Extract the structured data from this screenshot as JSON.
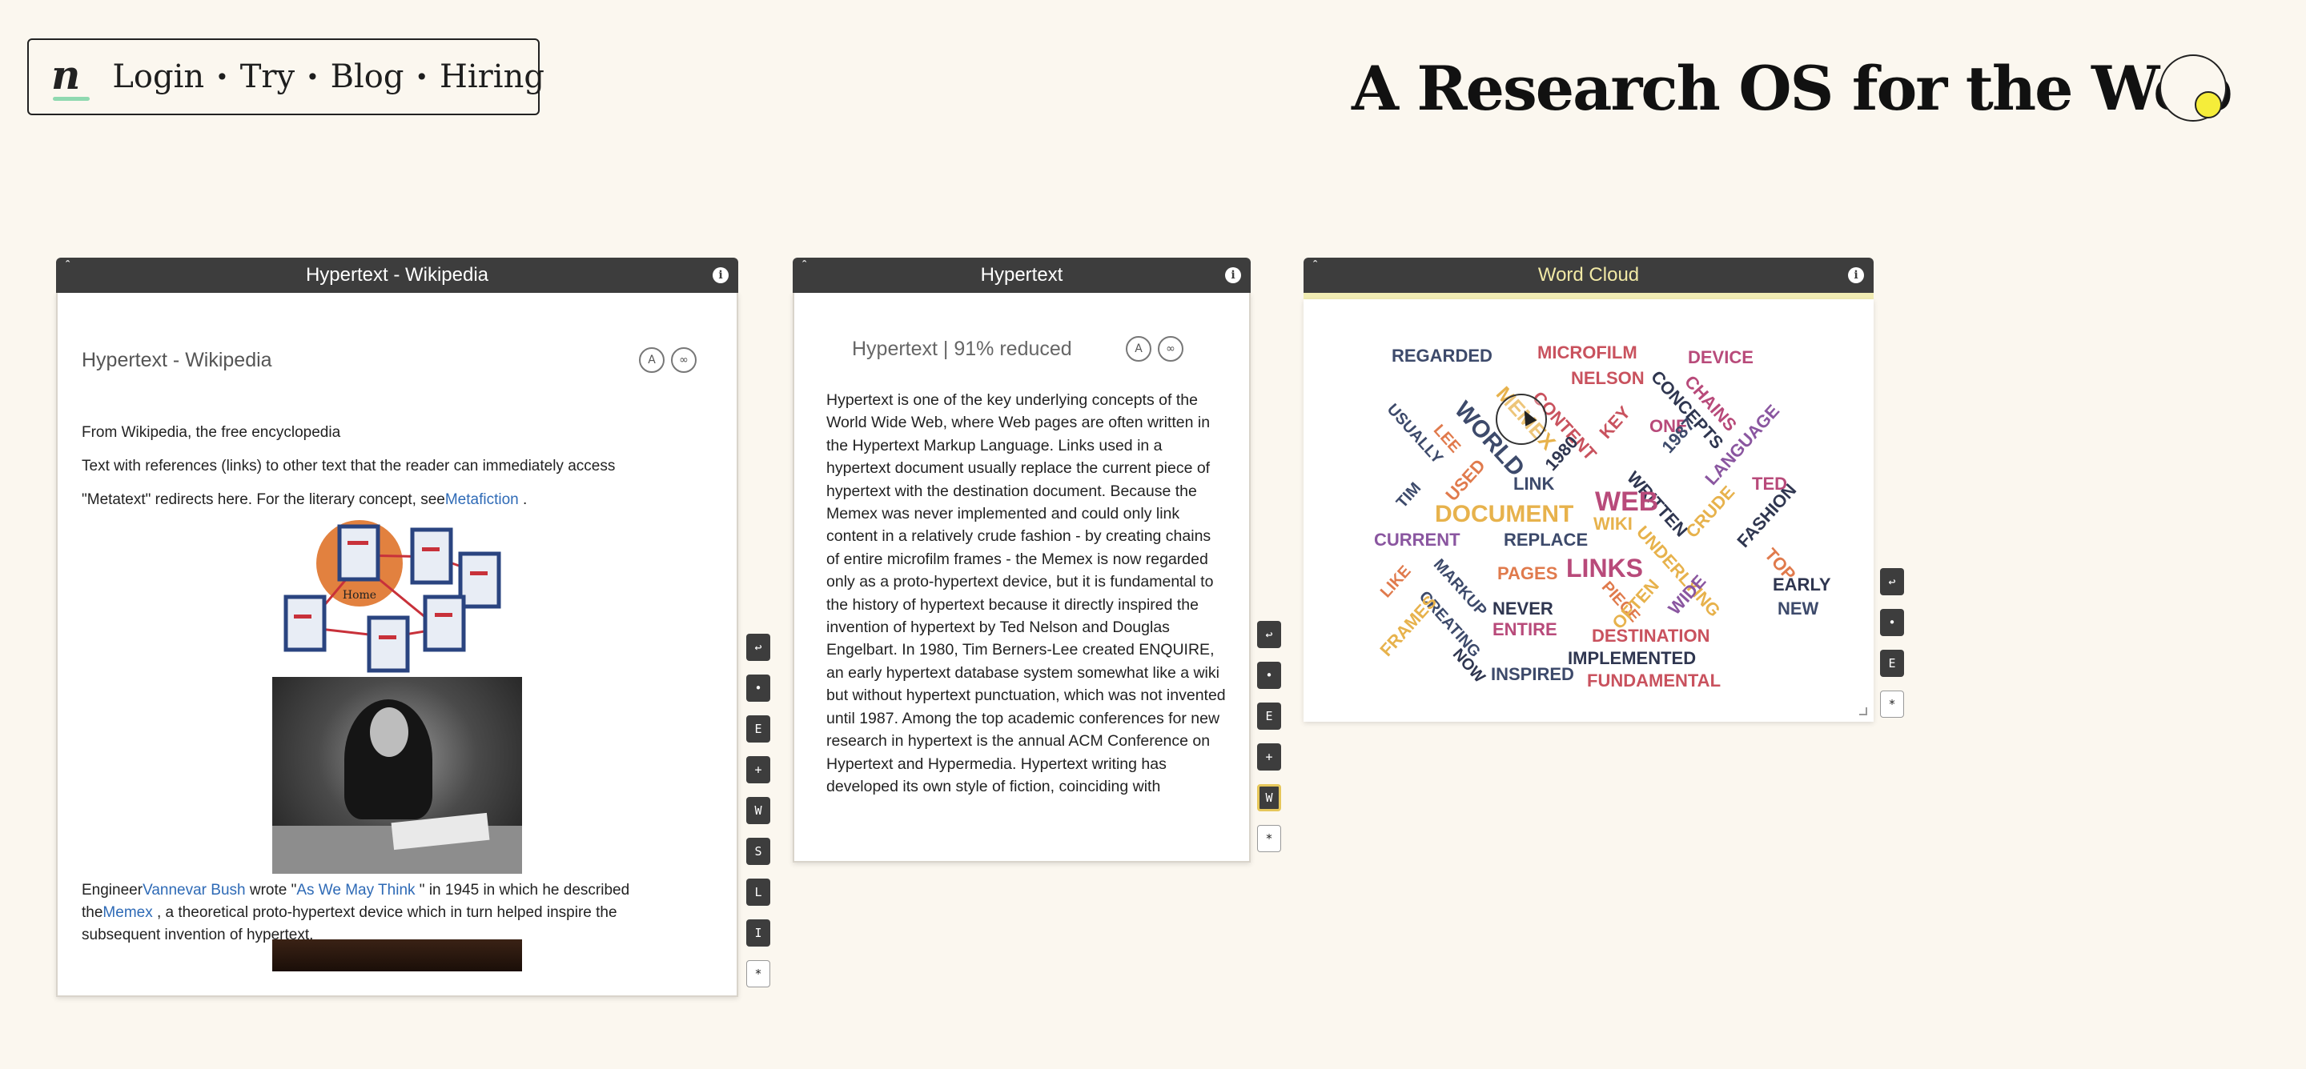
{
  "nav": {
    "items": [
      "Login",
      "Try",
      "Blog",
      "Hiring"
    ],
    "separator": "•",
    "logo_letter": "n"
  },
  "headline": "A Research OS for the Web",
  "panels": {
    "wikipedia": {
      "header": "Hypertext - Wikipedia",
      "title": "Hypertext - Wikipedia",
      "lines": [
        "From Wikipedia, the free encyclopedia",
        "Text with references (links) to other text that the reader can immediately access"
      ],
      "redirect_prefix": "\"Metatext\" redirects here. For the literary concept, see",
      "redirect_link": "Metafiction",
      "redirect_suffix": " .",
      "diagram_label": "Home",
      "caption": {
        "prefix": "Engineer",
        "link1": "Vannevar Bush",
        "mid1": " wrote \"",
        "link2": "As We May Think",
        "mid2": " \" in 1945 in which he described",
        "line2_prefix": "the",
        "link3": "Memex",
        "line2_suffix": " , a theoretical proto-hypertext device which in turn helped inspire the",
        "line3": "subsequent invention of hypertext."
      },
      "tools": [
        "↩",
        "•",
        "E",
        "+",
        "W",
        "S",
        "L",
        "I",
        "*"
      ]
    },
    "summary": {
      "header": "Hypertext",
      "title": "Hypertext | 91% reduced",
      "body": "Hypertext is one of the key underlying concepts of the World Wide Web, where Web pages are often written in the Hypertext Markup Language. Links used in a hypertext document usually replace the current piece of hypertext with the destination document. Because the Memex was never implemented and could only link content in a relatively crude fashion - by creating chains of entire microfilm frames - the Memex is now regarded only as a proto-hypertext device, but it is fundamental to the history of hypertext because it directly inspired the invention of hypertext by Ted Nelson and Douglas Engelbart. In 1980, Tim Berners-Lee created ENQUIRE, an early hypertext database system somewhat like a wiki but without hypertext punctuation, which was not invented until 1987. Among the top academic conferences for new research in hypertext is the annual ACM Conference on Hypertext and Hypermedia. Hypertext writing has developed its own style of fiction, coinciding with",
      "tools": [
        "↩",
        "•",
        "E",
        "+",
        "W",
        "*"
      ],
      "active_tool": "W"
    },
    "wordcloud": {
      "header": "Word Cloud",
      "tools": [
        "↩",
        "•",
        "E",
        "*"
      ],
      "words": [
        {
          "text": "REGARDED",
          "color": "#3d4a6b",
          "size": 22,
          "rot": 0
        },
        {
          "text": "MICROFILM",
          "color": "#c9525e",
          "size": 22,
          "rot": 0
        },
        {
          "text": "DEVICE",
          "color": "#b84a7a",
          "size": 22,
          "rot": 0
        },
        {
          "text": "NELSON",
          "color": "#c9525e",
          "size": 22,
          "rot": 0
        },
        {
          "text": "CONCEPTS",
          "color": "#2f3650",
          "size": 22,
          "rot": 48
        },
        {
          "text": "CHAINS",
          "color": "#b84a7a",
          "size": 22,
          "rot": 48
        },
        {
          "text": "MEMEX",
          "color": "#e7b24c",
          "size": 26,
          "rot": 48
        },
        {
          "text": "CONTENT",
          "color": "#c9525e",
          "size": 22,
          "rot": 48
        },
        {
          "text": "WORLD",
          "color": "#3d4a6b",
          "size": 30,
          "rot": 48
        },
        {
          "text": "USUALLY",
          "color": "#3d4a6b",
          "size": 20,
          "rot": 48
        },
        {
          "text": "LEE",
          "color": "#e07a4c",
          "size": 20,
          "rot": 48
        },
        {
          "text": "KEY",
          "color": "#c9525e",
          "size": 22,
          "rot": -48
        },
        {
          "text": "ONE",
          "color": "#b84a7a",
          "size": 22,
          "rot": 0
        },
        {
          "text": "1987",
          "color": "#3d4a6b",
          "size": 22,
          "rot": -48
        },
        {
          "text": "LANGUAGE",
          "color": "#8a56a0",
          "size": 22,
          "rot": -48
        },
        {
          "text": "1980",
          "color": "#2f3650",
          "size": 22,
          "rot": -48
        },
        {
          "text": "TIM",
          "color": "#3d4a6b",
          "size": 20,
          "rot": -48
        },
        {
          "text": "USED",
          "color": "#e07a4c",
          "size": 22,
          "rot": -48
        },
        {
          "text": "LINK",
          "color": "#3d4a6b",
          "size": 22,
          "rot": 0
        },
        {
          "text": "WRITTEN",
          "color": "#2f3650",
          "size": 22,
          "rot": 48
        },
        {
          "text": "TED",
          "color": "#b84a7a",
          "size": 22,
          "rot": 0
        },
        {
          "text": "WEB",
          "color": "#b84a7a",
          "size": 34,
          "rot": 0
        },
        {
          "text": "DOCUMENT",
          "color": "#e7b24c",
          "size": 30,
          "rot": 0
        },
        {
          "text": "WIKI",
          "color": "#e7b24c",
          "size": 22,
          "rot": 0
        },
        {
          "text": "CRUDE",
          "color": "#e7b24c",
          "size": 22,
          "rot": -48
        },
        {
          "text": "FASHION",
          "color": "#2f3650",
          "size": 22,
          "rot": -48
        },
        {
          "text": "CURRENT",
          "color": "#8a56a0",
          "size": 22,
          "rot": 0
        },
        {
          "text": "REPLACE",
          "color": "#3d4a6b",
          "size": 22,
          "rot": 0
        },
        {
          "text": "UNDERLYING",
          "color": "#e7b24c",
          "size": 22,
          "rot": 48
        },
        {
          "text": "TOP",
          "color": "#e07a4c",
          "size": 22,
          "rot": 48
        },
        {
          "text": "LINKS",
          "color": "#b84a7a",
          "size": 32,
          "rot": 0
        },
        {
          "text": "LIKE",
          "color": "#e07a4c",
          "size": 20,
          "rot": -48
        },
        {
          "text": "MARKUP",
          "color": "#3d4a6b",
          "size": 20,
          "rot": 48
        },
        {
          "text": "PAGES",
          "color": "#e07a4c",
          "size": 22,
          "rot": 0
        },
        {
          "text": "PIECE",
          "color": "#e07a4c",
          "size": 20,
          "rot": 48
        },
        {
          "text": "EARLY",
          "color": "#2f3650",
          "size": 22,
          "rot": 0
        },
        {
          "text": "WIDE",
          "color": "#8a56a0",
          "size": 22,
          "rot": -48
        },
        {
          "text": "OFTEN",
          "color": "#e7b24c",
          "size": 22,
          "rot": -48
        },
        {
          "text": "NEW",
          "color": "#3d4a6b",
          "size": 22,
          "rot": 0
        },
        {
          "text": "CREATING",
          "color": "#3d4a6b",
          "size": 20,
          "rot": 48
        },
        {
          "text": "NEVER",
          "color": "#2f3650",
          "size": 22,
          "rot": 0
        },
        {
          "text": "ENTIRE",
          "color": "#b84a7a",
          "size": 22,
          "rot": 0
        },
        {
          "text": "DESTINATION",
          "color": "#c9525e",
          "size": 22,
          "rot": 0
        },
        {
          "text": "FRAMES",
          "color": "#e7b24c",
          "size": 22,
          "rot": -48
        },
        {
          "text": "NOW",
          "color": "#2f3650",
          "size": 20,
          "rot": 48
        },
        {
          "text": "IMPLEMENTED",
          "color": "#2f3650",
          "size": 22,
          "rot": 0
        },
        {
          "text": "INSPIRED",
          "color": "#3d4a6b",
          "size": 22,
          "rot": 0
        },
        {
          "text": "FUNDAMENTAL",
          "color": "#c9525e",
          "size": 22,
          "rot": 0
        }
      ]
    }
  }
}
